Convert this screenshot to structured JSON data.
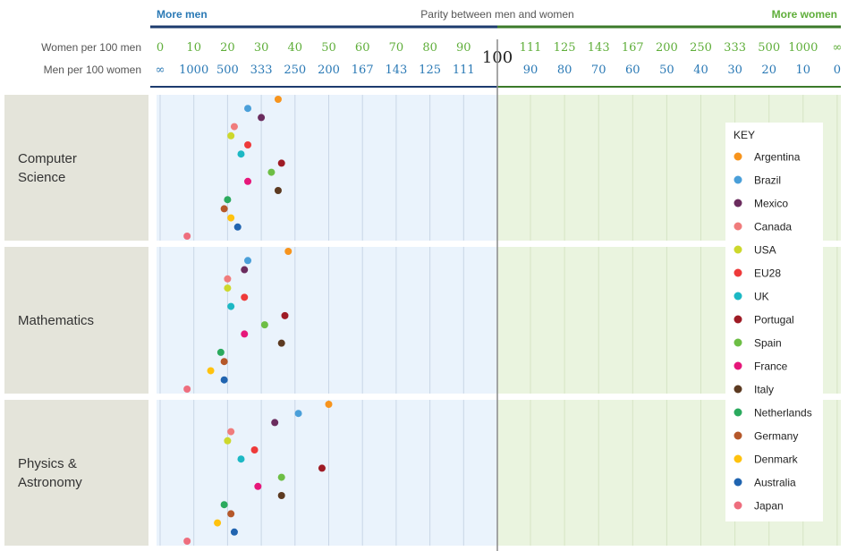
{
  "chart_data": {
    "type": "scatter",
    "header": {
      "left": "More men",
      "center": "Parity between men and women",
      "right": "More women",
      "parity_label": "100"
    },
    "axis": {
      "women_label": "Women per 100 men",
      "men_label": "Men per 100 women",
      "women_ticks_left": [
        "0",
        "10",
        "20",
        "30",
        "40",
        "50",
        "60",
        "70",
        "80",
        "90"
      ],
      "men_ticks_left": [
        "∞",
        "1000",
        "500",
        "333",
        "250",
        "200",
        "167",
        "143",
        "125",
        "111"
      ],
      "women_ticks_right": [
        "111",
        "125",
        "143",
        "167",
        "200",
        "250",
        "333",
        "500",
        "1000",
        "∞"
      ],
      "men_ticks_right": [
        "90",
        "80",
        "70",
        "60",
        "50",
        "40",
        "30",
        "20",
        "10",
        "0"
      ]
    },
    "key_title": "KEY",
    "series": [
      {
        "name": "Argentina",
        "color": "#F7941D"
      },
      {
        "name": "Brazil",
        "color": "#4A9FD9"
      },
      {
        "name": "Mexico",
        "color": "#6B2C5E"
      },
      {
        "name": "Canada",
        "color": "#F07C7C"
      },
      {
        "name": "USA",
        "color": "#CDD82C"
      },
      {
        "name": "EU28",
        "color": "#EE3A3A"
      },
      {
        "name": "UK",
        "color": "#1CB8C4"
      },
      {
        "name": "Portugal",
        "color": "#9E1B25"
      },
      {
        "name": "Spain",
        "color": "#6DBE45"
      },
      {
        "name": "France",
        "color": "#E6177A"
      },
      {
        "name": "Italy",
        "color": "#5C3A21"
      },
      {
        "name": "Netherlands",
        "color": "#2BAA5E"
      },
      {
        "name": "Germany",
        "color": "#B5582A"
      },
      {
        "name": "Denmark",
        "color": "#FFC20E"
      },
      {
        "name": "Australia",
        "color": "#2064B0"
      },
      {
        "name": "Japan",
        "color": "#EE6E7E"
      }
    ],
    "categories": [
      {
        "name": "Computer Science",
        "values": [
          35,
          26,
          30,
          22,
          21,
          26,
          24,
          36,
          33,
          26,
          35,
          20,
          19,
          21,
          23,
          8
        ]
      },
      {
        "name": "Mathematics",
        "values": [
          38,
          26,
          25,
          20,
          20,
          25,
          21,
          37,
          31,
          25,
          36,
          18,
          19,
          15,
          19,
          8
        ]
      },
      {
        "name": "Physics & Astronomy",
        "values": [
          50,
          41,
          34,
          21,
          20,
          28,
          24,
          48,
          36,
          29,
          36,
          19,
          21,
          17,
          22,
          8
        ]
      }
    ],
    "xlabel_scale": "women per 100 men",
    "xlim": [
      0,
      100
    ]
  }
}
